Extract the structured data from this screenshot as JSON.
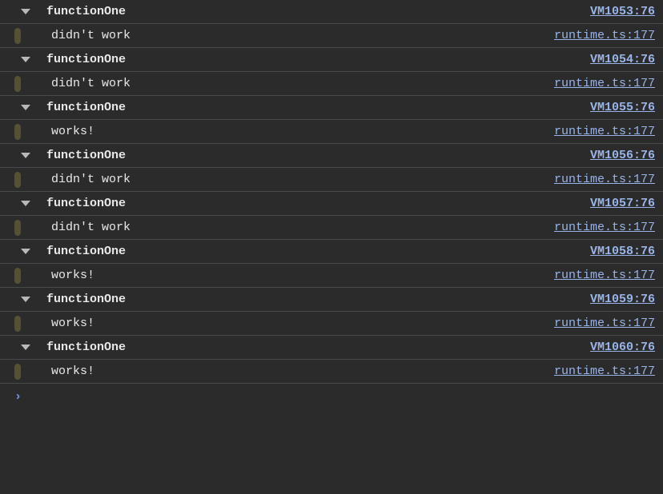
{
  "entries": [
    {
      "func": "functionOne",
      "funcSrc": "VM1053:76",
      "msg": "didn't work",
      "msgSrc": "runtime.ts:177"
    },
    {
      "func": "functionOne",
      "funcSrc": "VM1054:76",
      "msg": "didn't work",
      "msgSrc": "runtime.ts:177"
    },
    {
      "func": "functionOne",
      "funcSrc": "VM1055:76",
      "msg": "works!",
      "msgSrc": "runtime.ts:177"
    },
    {
      "func": "functionOne",
      "funcSrc": "VM1056:76",
      "msg": "didn't work",
      "msgSrc": "runtime.ts:177"
    },
    {
      "func": "functionOne",
      "funcSrc": "VM1057:76",
      "msg": "didn't work",
      "msgSrc": "runtime.ts:177"
    },
    {
      "func": "functionOne",
      "funcSrc": "VM1058:76",
      "msg": "works!",
      "msgSrc": "runtime.ts:177"
    },
    {
      "func": "functionOne",
      "funcSrc": "VM1059:76",
      "msg": "works!",
      "msgSrc": "runtime.ts:177"
    },
    {
      "func": "functionOne",
      "funcSrc": "VM1060:76",
      "msg": "works!",
      "msgSrc": "runtime.ts:177"
    }
  ],
  "prompt": "›"
}
